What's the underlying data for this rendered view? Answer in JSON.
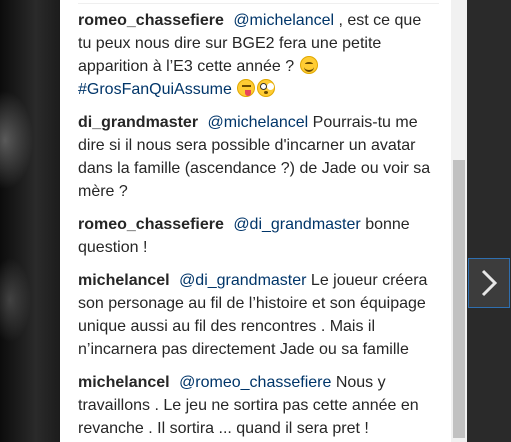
{
  "comments": [
    {
      "username": "romeo_chassefiere",
      "mention": "@michelancel",
      "text": " , est ce que tu peux nous dire sur BGE2 fera une petite apparition à l’E3 cette année ?",
      "hashtag": "#GrosFanQuiAssume"
    },
    {
      "username": "di_grandmaster",
      "mention": "@michelancel",
      "text": " Pourrais-tu me dire si il nous sera possible d'incarner un avatar dans la famille (ascendance ?) de Jade ou voir sa mère ?"
    },
    {
      "username": "romeo_chassefiere",
      "mention": "@di_grandmaster",
      "text": "bonne question !"
    },
    {
      "username": "michelancel",
      "mention": "@di_grandmaster",
      "text": " Le joueur créera son personage au fil de l’histoire et son équipage unique aussi au fil des rencontres . Mais il n’incarnera pas directement Jade ou sa famille"
    },
    {
      "username": "michelancel",
      "mention": "@romeo_chassefiere",
      "text": " Nous y travaillons . Le jeu ne sortira pas cette année en revanche . Il sortira ... quand il sera pret !"
    }
  ],
  "icons": {
    "emoji_1": "smiling-face-emoji",
    "emoji_2": "face-with-tongue-emoji",
    "emoji_3": "flushed-face-emoji",
    "next": "chevron-right-icon"
  },
  "colors": {
    "link": "#003569",
    "text": "#262626",
    "nav_border": "#2f6fb0"
  }
}
